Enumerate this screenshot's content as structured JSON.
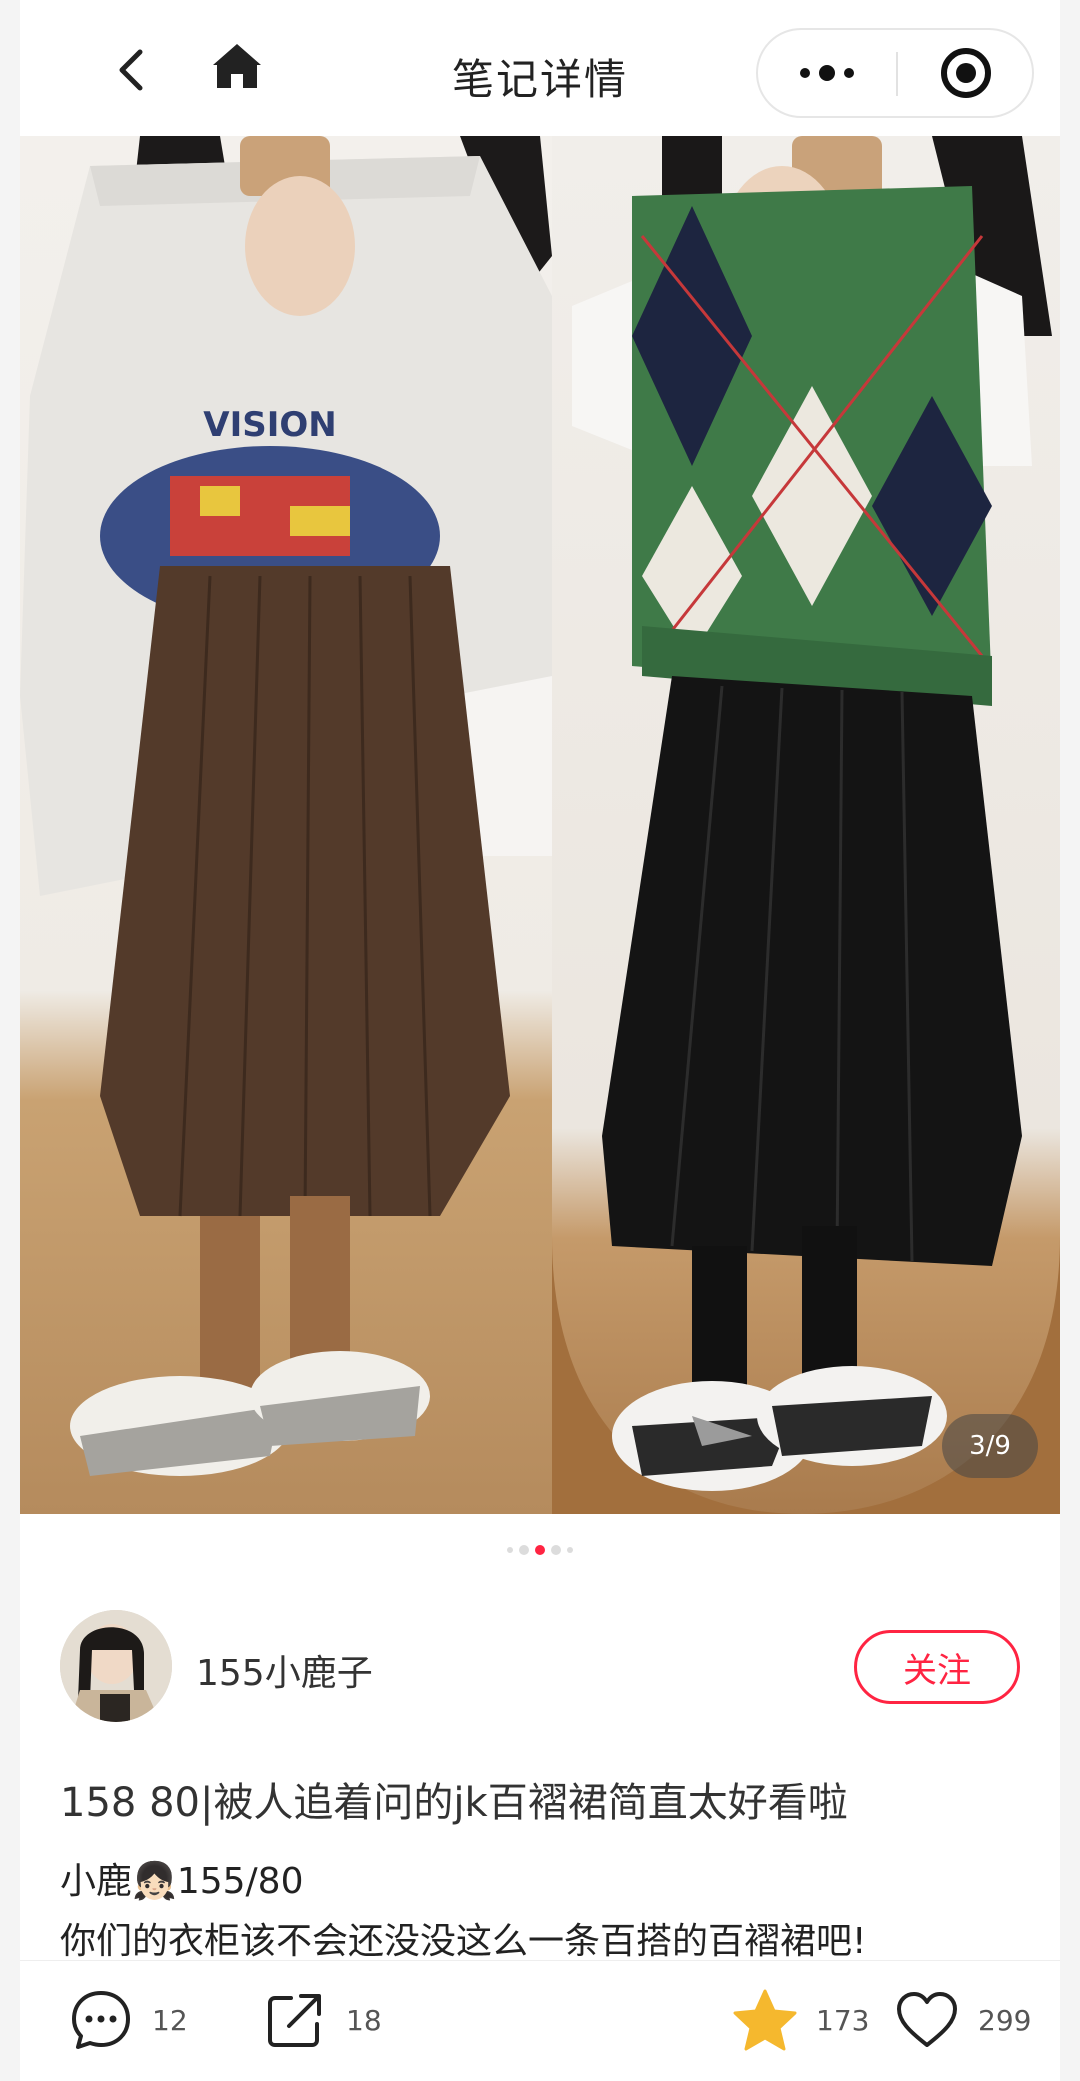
{
  "header": {
    "title": "笔记详情",
    "back_icon": "back-arrow-icon",
    "home_icon": "home-icon",
    "more_icon": "more-dots-icon",
    "close_icon": "target-close-icon"
  },
  "gallery": {
    "counter": "3/9",
    "current_index": 3,
    "total": 9
  },
  "author": {
    "name": "155小鹿子",
    "follow_label": "关注"
  },
  "note": {
    "title": "158 80|被人追着问的jk百褶裙简直太好看啦",
    "body_line1": "小鹿👧🏻155/80",
    "body_line2": "你们的衣柜该不会还没没这么一条百搭的百褶裙吧!"
  },
  "actions": {
    "comment_count": "12",
    "share_count": "18",
    "collect_count": "173",
    "like_count": "299"
  },
  "colors": {
    "accent": "#ff2442",
    "star": "#f5b82e",
    "text": "#222222"
  }
}
